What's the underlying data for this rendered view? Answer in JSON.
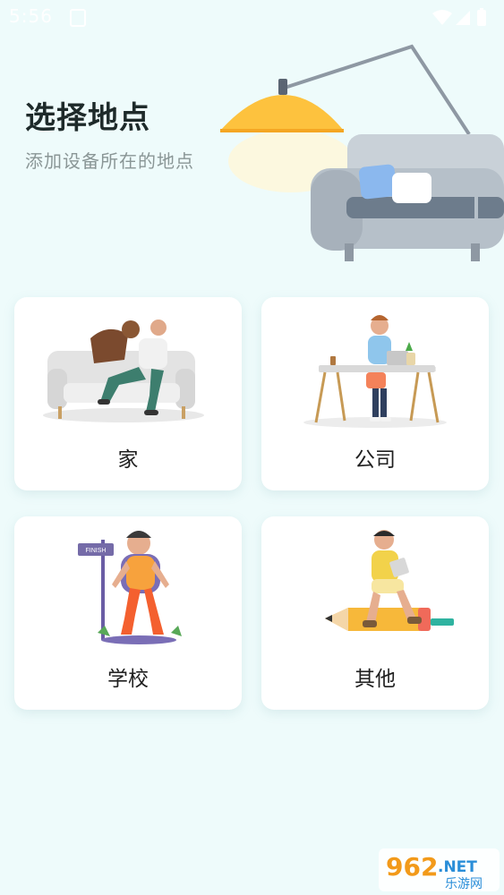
{
  "status": {
    "time": "5:56"
  },
  "header": {
    "title": "选择地点",
    "subtitle": "添加设备所在的地点"
  },
  "locations": [
    {
      "label": "家",
      "icon": "home-illustration"
    },
    {
      "label": "公司",
      "icon": "office-illustration"
    },
    {
      "label": "学校",
      "icon": "school-illustration"
    },
    {
      "label": "其他",
      "icon": "other-illustration"
    }
  ],
  "watermark": {
    "number": "962",
    "suffix": ".NET",
    "brand": "乐游网"
  },
  "colors": {
    "background": "#eefbfb",
    "card": "#ffffff",
    "lamp": "#fdc23e",
    "sofa": "#c9d1d8"
  }
}
